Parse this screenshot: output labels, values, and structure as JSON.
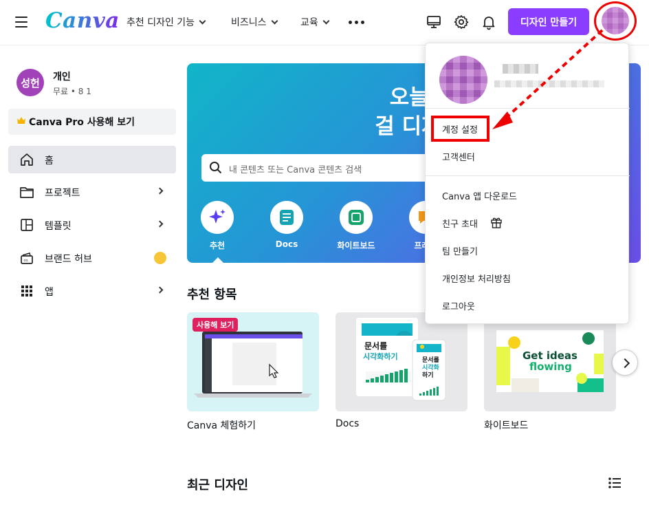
{
  "header": {
    "logo": "Canva",
    "nav": [
      "추천 디자인 기능",
      "비즈니스",
      "교육"
    ],
    "create_label": "디자인 만들기"
  },
  "sidebar": {
    "avatar_initials": "성헌",
    "account_name": "개인",
    "account_sub": "무료 • 8 1",
    "pro_label": "Canva Pro 사용해 보기",
    "items": [
      {
        "label": "홈"
      },
      {
        "label": "프로젝트"
      },
      {
        "label": "템플릿"
      },
      {
        "label": "브랜드 허브"
      },
      {
        "label": "앱"
      }
    ]
  },
  "hero": {
    "title_line1": "오늘은 (",
    "title_line2": "걸 디자인할",
    "search_placeholder": "내 콘텐츠 또는 Canva 콘텐츠 검색",
    "categories": [
      "추천",
      "Docs",
      "화이트보드",
      "프레젠"
    ]
  },
  "recommended": {
    "title": "추천 항목",
    "try_badge": "사용해 보기",
    "cards": [
      "Canva 체험하기",
      "Docs",
      "화이트보드"
    ],
    "doc_card_text1": "문서를",
    "doc_card_text2": "시각화하기",
    "doc_card_small1": "문서를",
    "doc_card_small2": "시각화",
    "doc_card_small3": "하기",
    "whiteboard_text1": "Get ideas",
    "whiteboard_text2": "flowing"
  },
  "recent": {
    "title": "최근 디자인"
  },
  "dropdown": {
    "items_group1": [
      "계정 설정",
      "고객센터"
    ],
    "items_group2": [
      "Canva 앱 다운로드",
      "친구 초대",
      "팀 만들기",
      "개인정보 처리방침",
      "로그아웃"
    ]
  },
  "colors": {
    "primary": "#8b3dff",
    "annotation": "#e00000",
    "hero_start": "#11b5c8",
    "hero_end": "#6a4ee8"
  }
}
